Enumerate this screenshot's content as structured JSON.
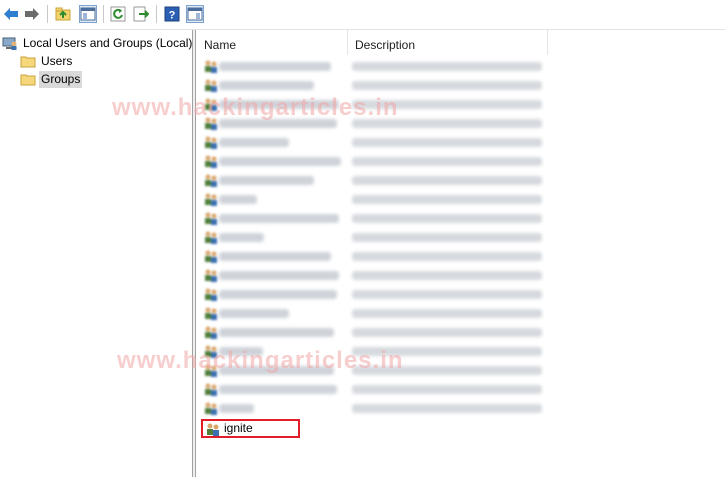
{
  "toolbar": {
    "buttons": [
      {
        "name": "back-arrow-icon"
      },
      {
        "name": "forward-arrow-icon"
      },
      {
        "name": "up-folder-icon"
      },
      {
        "name": "show-hide-console-tree-icon"
      },
      {
        "name": "refresh-icon"
      },
      {
        "name": "export-list-icon"
      },
      {
        "name": "help-icon"
      },
      {
        "name": "show-hide-action-pane-icon"
      }
    ]
  },
  "tree": {
    "root_label": "Local Users and Groups (Local)",
    "children": [
      {
        "label": "Users",
        "selected": false
      },
      {
        "label": "Groups",
        "selected": true
      }
    ]
  },
  "list": {
    "columns": [
      "Name",
      "Description"
    ],
    "highlighted_item": "ignite"
  },
  "watermark": {
    "text": "www.hackingarticles.in"
  },
  "colors": {
    "highlight_border": "#e11d2a",
    "selection": "#d9d9d9"
  }
}
